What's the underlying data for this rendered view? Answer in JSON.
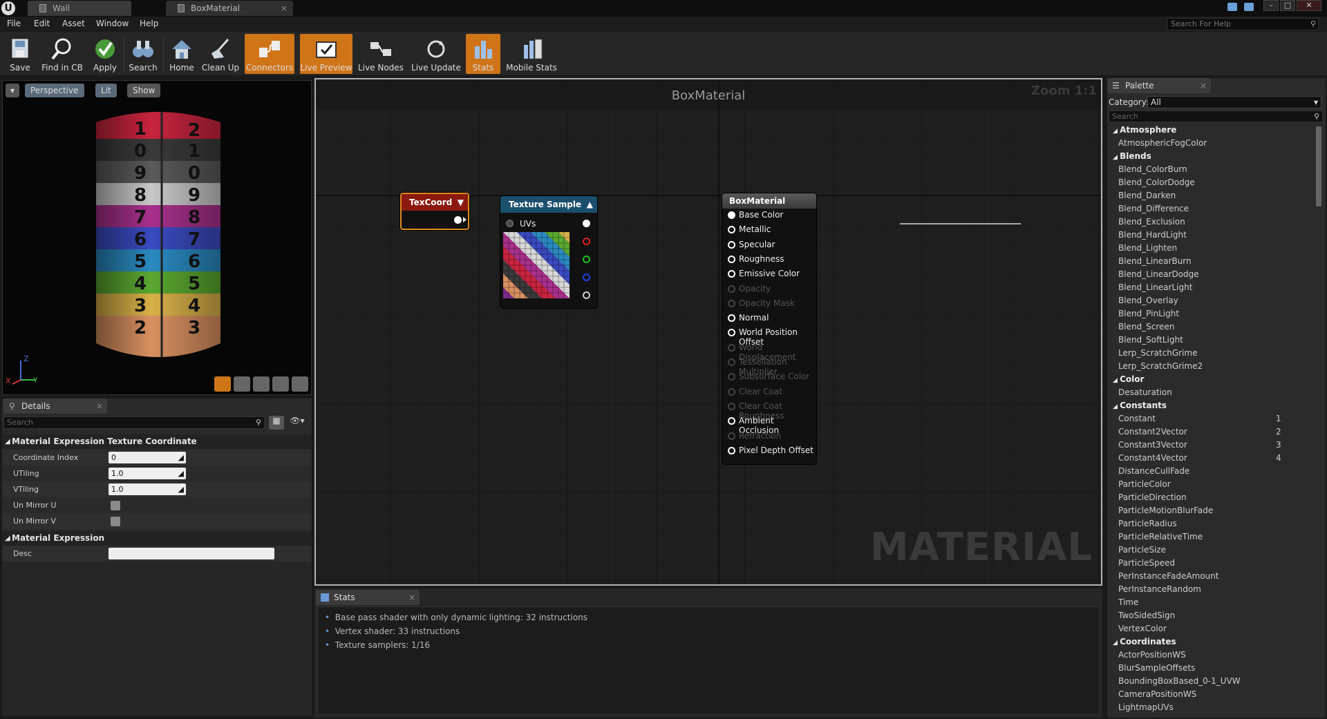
{
  "tabs": [
    {
      "label": "Wall"
    },
    {
      "label": "BoxMaterial"
    }
  ],
  "menu": [
    "File",
    "Edit",
    "Asset",
    "Window",
    "Help"
  ],
  "help_search": {
    "placeholder": "Search For Help"
  },
  "toolbar": [
    {
      "label": "Save",
      "icon": "save-icon",
      "active": false
    },
    {
      "label": "Find in CB",
      "icon": "magnifier-icon",
      "active": false
    },
    {
      "label": "Apply",
      "icon": "checkmark-icon",
      "active": false
    },
    {
      "label": "Search",
      "icon": "binoculars-icon",
      "active": false
    },
    {
      "label": "Home",
      "icon": "home-icon",
      "active": false
    },
    {
      "label": "Clean Up",
      "icon": "broom-icon",
      "active": false
    },
    {
      "label": "Connectors",
      "icon": "connectors-icon",
      "active": true
    },
    {
      "label": "Live Preview",
      "icon": "live-preview-icon",
      "active": true
    },
    {
      "label": "Live Nodes",
      "icon": "live-nodes-icon",
      "active": false
    },
    {
      "label": "Live Update",
      "icon": "live-update-icon",
      "active": false
    },
    {
      "label": "Stats",
      "icon": "stats-icon",
      "active": true
    },
    {
      "label": "Mobile Stats",
      "icon": "mobile-stats-icon",
      "active": false
    }
  ],
  "viewport": {
    "perspective": "Perspective",
    "lit": "Lit",
    "show": "Show",
    "axis_z": "Z",
    "axis_y": "Y",
    "axis_x": "X"
  },
  "details": {
    "tab": "Details",
    "search_placeholder": "Search",
    "category1": "Material Expression Texture Coordinate",
    "props": [
      {
        "label": "Coordinate Index",
        "value": "0",
        "type": "input"
      },
      {
        "label": "UTiling",
        "value": "1.0",
        "type": "input"
      },
      {
        "label": "VTiling",
        "value": "1.0",
        "type": "input"
      },
      {
        "label": "Un Mirror U",
        "type": "check"
      },
      {
        "label": "Un Mirror V",
        "type": "check"
      }
    ],
    "category2": "Material Expression",
    "desc_label": "Desc",
    "desc_value": ""
  },
  "graph": {
    "title": "BoxMaterial",
    "zoom": "Zoom 1:1",
    "watermark": "MATERIAL",
    "texcoord_title": "TexCoord",
    "texsample_title": "Texture Sample",
    "texsample_input": "UVs",
    "result_title": "BoxMaterial",
    "result_pins": [
      {
        "label": "Base Color",
        "enabled": true,
        "connected": true
      },
      {
        "label": "Metallic",
        "enabled": true
      },
      {
        "label": "Specular",
        "enabled": true
      },
      {
        "label": "Roughness",
        "enabled": true
      },
      {
        "label": "Emissive Color",
        "enabled": true
      },
      {
        "label": "Opacity",
        "enabled": false
      },
      {
        "label": "Opacity Mask",
        "enabled": false
      },
      {
        "label": "Normal",
        "enabled": true
      },
      {
        "label": "World Position Offset",
        "enabled": true
      },
      {
        "label": "World Displacement",
        "enabled": false
      },
      {
        "label": "Tessellation Multiplier",
        "enabled": false
      },
      {
        "label": "Subsurface Color",
        "enabled": false
      },
      {
        "label": "Clear Coat",
        "enabled": false
      },
      {
        "label": "Clear Coat Roughness",
        "enabled": false
      },
      {
        "label": "Ambient Occlusion",
        "enabled": true
      },
      {
        "label": "Refraction",
        "enabled": false
      },
      {
        "label": "Pixel Depth Offset",
        "enabled": true
      }
    ]
  },
  "stats": {
    "tab": "Stats",
    "lines": [
      "Base pass shader with only dynamic lighting: 32 instructions",
      "Vertex shader: 33 instructions",
      "Texture samplers: 1/16"
    ]
  },
  "palette": {
    "tab": "Palette",
    "category_label": "Category:",
    "category_value": "All",
    "search_placeholder": "Search",
    "entries": [
      {
        "t": "c",
        "label": "Atmosphere"
      },
      {
        "t": "i",
        "label": "AtmosphericFogColor"
      },
      {
        "t": "c",
        "label": "Blends"
      },
      {
        "t": "i",
        "label": "Blend_ColorBurn"
      },
      {
        "t": "i",
        "label": "Blend_ColorDodge"
      },
      {
        "t": "i",
        "label": "Blend_Darken"
      },
      {
        "t": "i",
        "label": "Blend_Difference"
      },
      {
        "t": "i",
        "label": "Blend_Exclusion"
      },
      {
        "t": "i",
        "label": "Blend_HardLight"
      },
      {
        "t": "i",
        "label": "Blend_Lighten"
      },
      {
        "t": "i",
        "label": "Blend_LinearBurn"
      },
      {
        "t": "i",
        "label": "Blend_LinearDodge"
      },
      {
        "t": "i",
        "label": "Blend_LinearLight"
      },
      {
        "t": "i",
        "label": "Blend_Overlay"
      },
      {
        "t": "i",
        "label": "Blend_PinLight"
      },
      {
        "t": "i",
        "label": "Blend_Screen"
      },
      {
        "t": "i",
        "label": "Blend_SoftLight"
      },
      {
        "t": "i",
        "label": "Lerp_ScratchGrime"
      },
      {
        "t": "i",
        "label": "Lerp_ScratchGrime2"
      },
      {
        "t": "c",
        "label": "Color"
      },
      {
        "t": "i",
        "label": "Desaturation"
      },
      {
        "t": "c",
        "label": "Constants"
      },
      {
        "t": "i",
        "label": "Constant",
        "num": "1"
      },
      {
        "t": "i",
        "label": "Constant2Vector",
        "num": "2"
      },
      {
        "t": "i",
        "label": "Constant3Vector",
        "num": "3"
      },
      {
        "t": "i",
        "label": "Constant4Vector",
        "num": "4"
      },
      {
        "t": "i",
        "label": "DistanceCullFade"
      },
      {
        "t": "i",
        "label": "ParticleColor"
      },
      {
        "t": "i",
        "label": "ParticleDirection"
      },
      {
        "t": "i",
        "label": "ParticleMotionBlurFade"
      },
      {
        "t": "i",
        "label": "ParticleRadius"
      },
      {
        "t": "i",
        "label": "ParticleRelativeTime"
      },
      {
        "t": "i",
        "label": "ParticleSize"
      },
      {
        "t": "i",
        "label": "ParticleSpeed"
      },
      {
        "t": "i",
        "label": "PerInstanceFadeAmount"
      },
      {
        "t": "i",
        "label": "PerInstanceRandom"
      },
      {
        "t": "i",
        "label": "Time"
      },
      {
        "t": "i",
        "label": "TwoSidedSign"
      },
      {
        "t": "i",
        "label": "VertexColor"
      },
      {
        "t": "c",
        "label": "Coordinates"
      },
      {
        "t": "i",
        "label": "ActorPositionWS"
      },
      {
        "t": "i",
        "label": "BlurSampleOffsets"
      },
      {
        "t": "i",
        "label": "BoundingBoxBased_0-1_UVW"
      },
      {
        "t": "i",
        "label": "CameraPositionWS"
      },
      {
        "t": "i",
        "label": "LightmapUVs"
      }
    ]
  },
  "colors": {
    "accent": "#d07418",
    "texcoord_head": "#8b1a10",
    "texsample_head": "#1b4f6e",
    "result_head": "#4a4a4a"
  }
}
